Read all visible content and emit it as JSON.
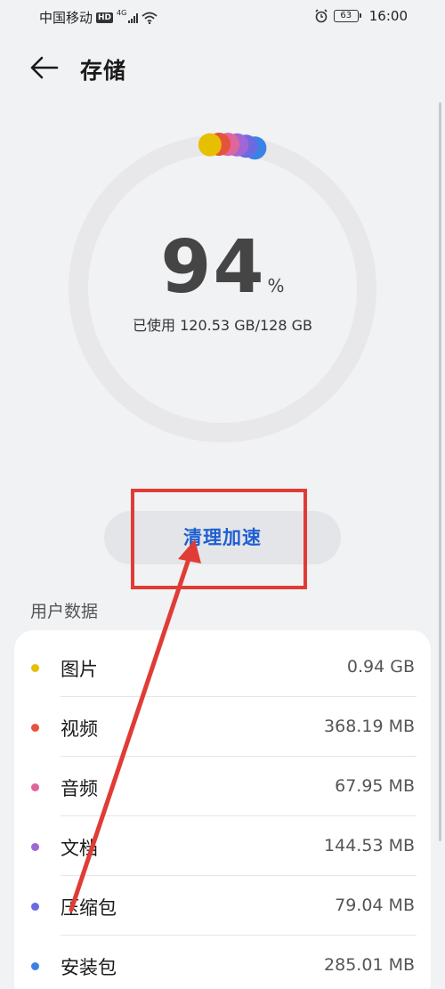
{
  "status_bar": {
    "carrier": "中国移动",
    "hd": "HD",
    "network": "4G",
    "battery": "63",
    "time": "16:00"
  },
  "header": {
    "title": "存储"
  },
  "storage": {
    "percent_number": "94",
    "percent_sign": "%",
    "usage_text": "已使用 120.53 GB/128 GB",
    "used_fraction": 0.94
  },
  "clean_button": {
    "label": "清理加速"
  },
  "user_data": {
    "section_label": "用户数据",
    "items": [
      {
        "label": "图片",
        "value": "0.94 GB",
        "color": "#e6c000"
      },
      {
        "label": "视频",
        "value": "368.19 MB",
        "color": "#e5533c"
      },
      {
        "label": "音频",
        "value": "67.95 MB",
        "color": "#e0659c"
      },
      {
        "label": "文档",
        "value": "144.53 MB",
        "color": "#a066d6"
      },
      {
        "label": "压缩包",
        "value": "79.04 MB",
        "color": "#6c6ae0"
      },
      {
        "label": "安装包",
        "value": "285.01 MB",
        "color": "#3a82e6"
      }
    ]
  },
  "colors": {
    "accent": "#1f5fd1",
    "annotation_red": "#e03c36",
    "ring_track": "#e8e8ea"
  }
}
